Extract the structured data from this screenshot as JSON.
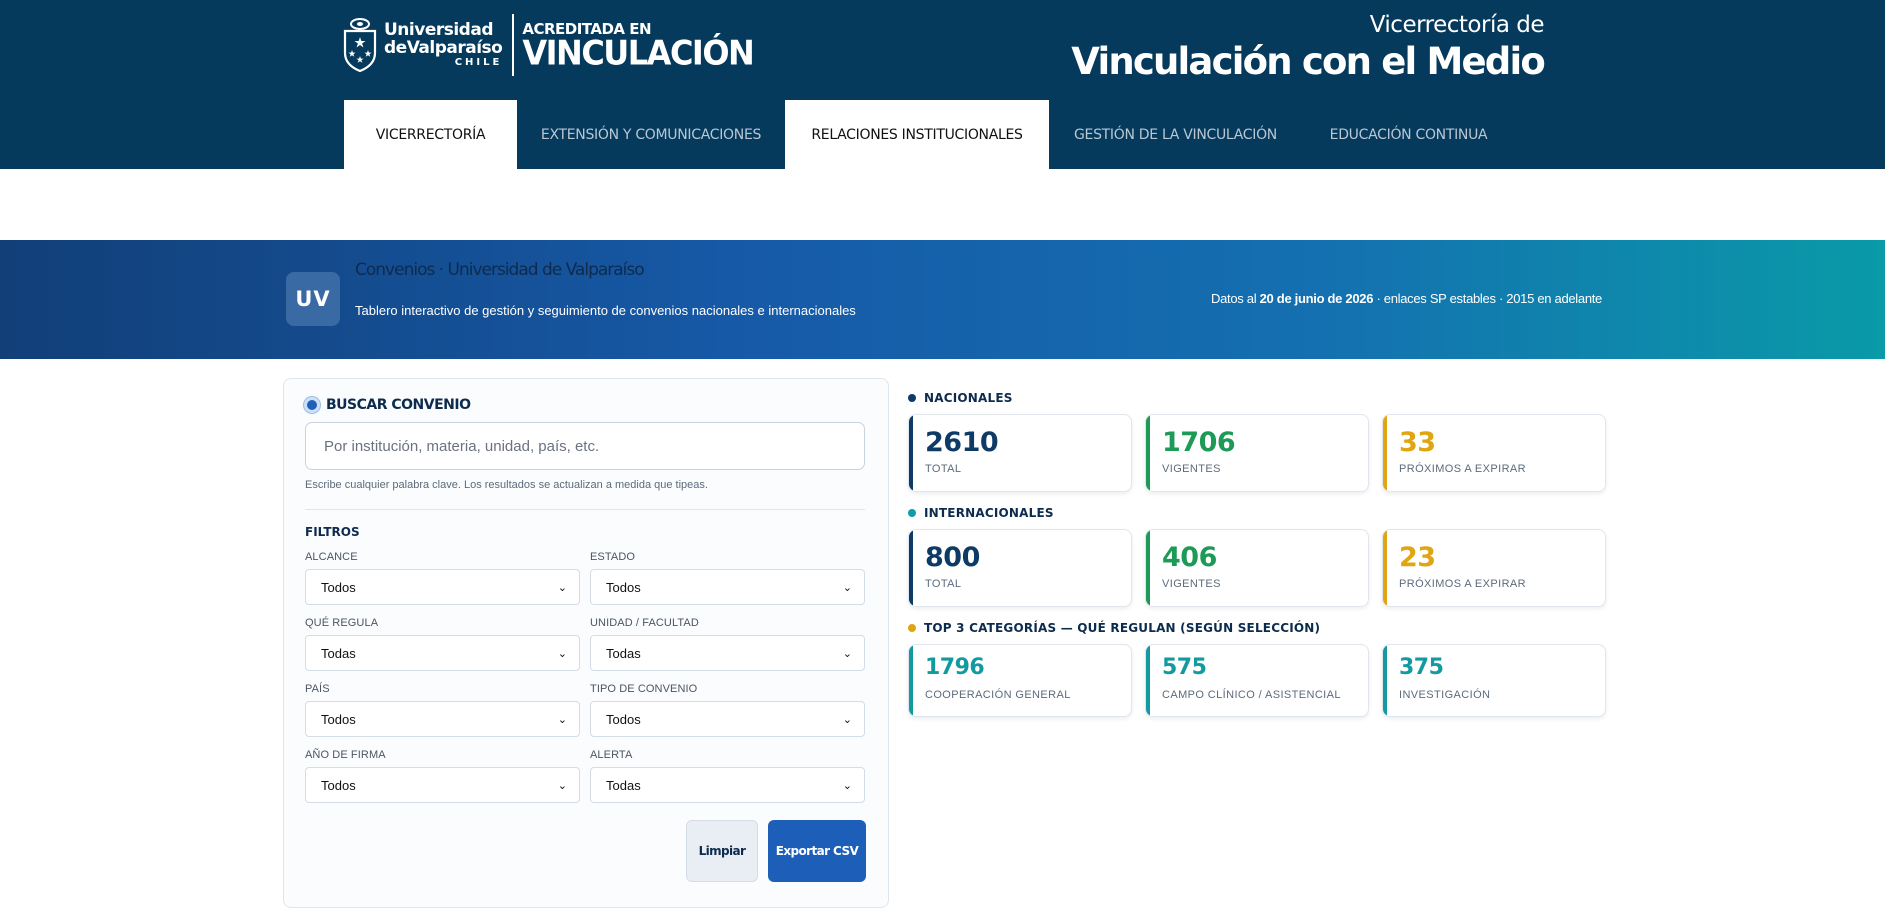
{
  "header": {
    "university_line1": "Universidad",
    "university_line2": "deValparaíso",
    "university_line3": "CHILE",
    "accredited_line1": "ACREDITADA EN",
    "accredited_line2": "VINCULACIÓN",
    "vice_line1": "Vicerrectoría de",
    "vice_line2": "Vinculación con el Medio"
  },
  "nav": {
    "items": [
      {
        "label": "VICERRECTORÍA",
        "active": true
      },
      {
        "label": "EXTENSIÓN Y COMUNICACIONES",
        "active": false
      },
      {
        "label": "RELACIONES INSTITUCIONALES",
        "active": true
      },
      {
        "label": "GESTIÓN DE LA VINCULACIÓN",
        "active": false
      },
      {
        "label": "EDUCACIÓN CONTINUA",
        "active": false
      }
    ]
  },
  "banner": {
    "badge": "UV",
    "title": "Convenios · Universidad de Valparaíso",
    "subtitle": "Tablero interactivo de gestión y seguimiento de convenios nacionales e internacionales",
    "date_prefix": "Datos al ",
    "date": "20 de junio de 2026",
    "date_suffix": " · enlaces SP estables · 2015 en adelante"
  },
  "search": {
    "title": "BUSCAR CONVENIO",
    "placeholder": "Por institución, materia, unidad, país, etc.",
    "hint": "Escribe cualquier palabra clave. Los resultados se actualizan a medida que tipeas.",
    "filters_title": "FILTROS",
    "filters": [
      {
        "label": "ALCANCE",
        "value": "Todos"
      },
      {
        "label": "ESTADO",
        "value": "Todos"
      },
      {
        "label": "QUÉ REGULA",
        "value": "Todas"
      },
      {
        "label": "UNIDAD / FACULTAD",
        "value": "Todas"
      },
      {
        "label": "PAÍS",
        "value": "Todos"
      },
      {
        "label": "TIPO DE CONVENIO",
        "value": "Todos"
      },
      {
        "label": "AÑO DE FIRMA",
        "value": "Todos"
      },
      {
        "label": "ALERTA",
        "value": "Todas"
      }
    ],
    "clear_label": "Limpiar",
    "export_label": "Exportar CSV"
  },
  "stats": {
    "nacionales": {
      "label": "NACIONALES",
      "color": "#0d3b66",
      "cards": [
        {
          "value": "2610",
          "label": "TOTAL",
          "color": "#0d3b66"
        },
        {
          "value": "1706",
          "label": "VIGENTES",
          "color": "#1e9a57"
        },
        {
          "value": "33",
          "label": "PRÓXIMOS A EXPIRAR",
          "color": "#e0a512"
        }
      ]
    },
    "internacionales": {
      "label": "INTERNACIONALES",
      "color": "#0f9ba8",
      "cards": [
        {
          "value": "800",
          "label": "TOTAL",
          "color": "#0d3b66"
        },
        {
          "value": "406",
          "label": "VIGENTES",
          "color": "#1e9a57"
        },
        {
          "value": "23",
          "label": "PRÓXIMOS A EXPIRAR",
          "color": "#e0a512"
        }
      ]
    },
    "top3": {
      "label": "TOP 3 CATEGORÍAS — QUÉ REGULAN (SEGÚN SELECCIÓN)",
      "color": "#e0a512",
      "cards": [
        {
          "value": "1796",
          "label": "COOPERACIÓN GENERAL",
          "color": "#139aa0"
        },
        {
          "value": "575",
          "label": "CAMPO CLÍNICO / ASISTENCIAL",
          "color": "#139aa0"
        },
        {
          "value": "375",
          "label": "INVESTIGACIÓN",
          "color": "#139aa0"
        }
      ]
    }
  }
}
